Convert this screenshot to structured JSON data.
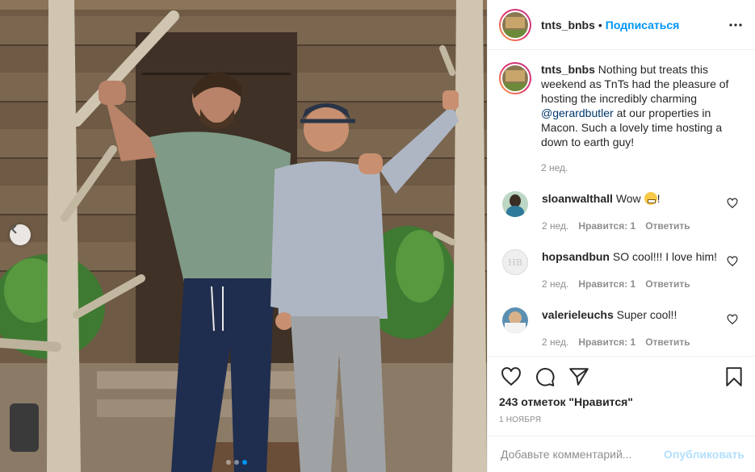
{
  "header": {
    "username": "tnts_bnbs",
    "separator": "•",
    "follow_label": "Подписаться"
  },
  "caption": {
    "username": "tnts_bnbs",
    "text_1": "Nothing but treats this weekend as TnTs had the pleasure of hosting the incredibly charming ",
    "mention": "@gerardbutler",
    "text_2": " at our properties in Macon. Such a lovely time hosting a down to earth guy!",
    "time": "2 нед."
  },
  "comments": [
    {
      "username": "sloanwalthall",
      "text": "Wow ",
      "text_after": "!",
      "emoji": "grimacing-face",
      "time": "2 нед.",
      "likes": "Нравится: 1",
      "reply": "Ответить"
    },
    {
      "username": "hopsandbun",
      "text": "SO cool!!! I love him!",
      "avatar_initials": "HB",
      "time": "2 нед.",
      "likes": "Нравится: 1",
      "reply": "Ответить"
    },
    {
      "username": "valerieleuchs",
      "text": "Super cool!!",
      "time": "2 нед.",
      "likes": "Нравится: 1",
      "reply": "Ответить"
    }
  ],
  "actions": {
    "likes_count": "243 отметок \"Нравится\"",
    "date": "1 НОЯБРЯ"
  },
  "add_comment": {
    "placeholder": "Добавьте комментарий...",
    "publish_label": "Опубликовать"
  },
  "carousel": {
    "total": 3,
    "current": 3
  },
  "colors": {
    "accent": "#0095f6",
    "publish_disabled": "#b2dffc",
    "meta": "#8e8e8e",
    "mention": "#00376b"
  }
}
